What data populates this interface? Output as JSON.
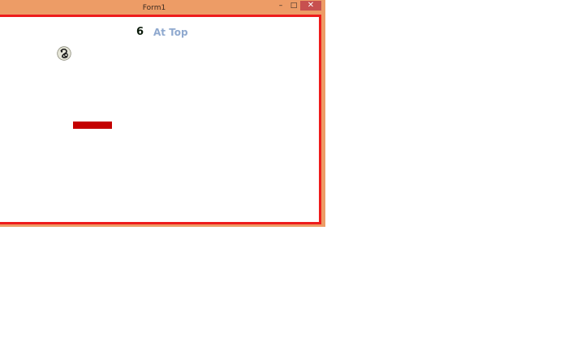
{
  "window": {
    "title": "Form1",
    "minimize_glyph": "–",
    "maximize_glyph": "□",
    "close_glyph": "✕"
  },
  "game": {
    "score": "6",
    "status": "At Top"
  },
  "colors": {
    "frame": "#ed9c66",
    "border": "#ee1c1c",
    "paddle": "#c40000",
    "status_text": "#8fa9cf",
    "close_button": "#c7504f"
  },
  "icons": {
    "ball": "soccer-ball-icon"
  }
}
